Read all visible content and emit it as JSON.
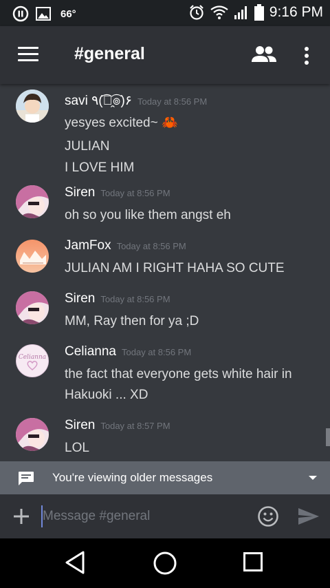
{
  "status_bar": {
    "notification_count": "66°",
    "time": "9:16 PM",
    "icons": [
      "pause-circle-icon",
      "image-icon",
      "alarm-icon",
      "wifi-icon",
      "signal-icon",
      "battery-icon"
    ]
  },
  "app_bar": {
    "channel_name": "#general",
    "icons": [
      "menu-icon",
      "members-icon",
      "more-vert-icon"
    ]
  },
  "messages": [
    {
      "author": "savi ٩(͡๏̯͡๏)۶",
      "timestamp": "Today at 8:56 PM",
      "lines": [
        "yesyes excited~ 🦀",
        "JULIAN",
        "I LOVE HIM"
      ],
      "avatar_color": "#c9b8a8"
    },
    {
      "author": "Siren",
      "timestamp": "Today at 8:56 PM",
      "lines": [
        "oh so you like them angst eh"
      ],
      "avatar_color": "#c86fa2"
    },
    {
      "author": "JamFox",
      "timestamp": "Today at 8:56 PM",
      "lines": [
        "JULIAN AM I RIGHT HAHA SO CUTE"
      ],
      "avatar_color": "#f2a07a"
    },
    {
      "author": "Siren",
      "timestamp": "Today at 8:56 PM",
      "lines": [
        "MM, Ray then for ya ;D"
      ],
      "avatar_color": "#c86fa2"
    },
    {
      "author": "Celianna",
      "timestamp": "Today at 8:56 PM",
      "lines": [
        "the fact that everyone gets white hair in",
        "Hakuoki ... XD"
      ],
      "avatar_color": "#f5e8f2",
      "avatar_text": "Celianna"
    },
    {
      "author": "Siren",
      "timestamp": "Today at 8:57 PM",
      "lines": [
        "LOL"
      ],
      "avatar_color": "#c86fa2"
    }
  ],
  "older_banner": {
    "text": "You're viewing older messages",
    "icon": "message-icon"
  },
  "composer": {
    "placeholder": "Message #general",
    "icons": [
      "plus-icon",
      "emoji-icon",
      "send-icon"
    ]
  },
  "colors": {
    "background": "#36393e",
    "app_bar": "#2f3136",
    "accent": "#7289da",
    "timestamp": "#72767d",
    "banner": "#5f646c"
  }
}
